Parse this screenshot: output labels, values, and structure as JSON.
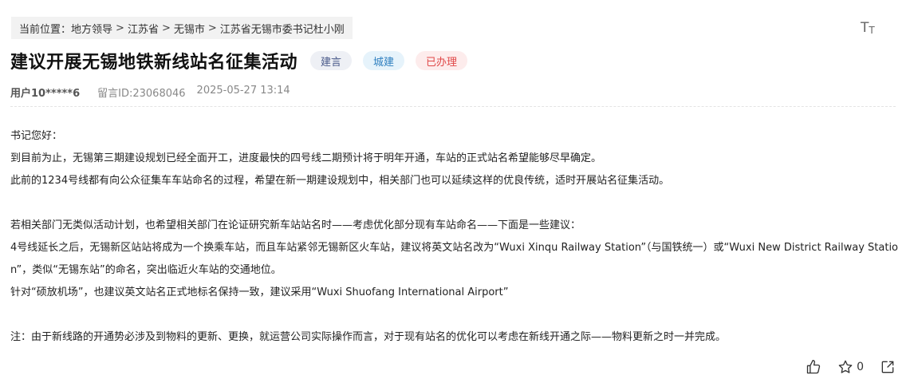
{
  "breadcrumb": {
    "prefix": "当前位置：",
    "items": [
      "地方领导",
      "江苏省",
      "无锡市",
      "江苏省无锡市委书记杜小刚"
    ],
    "separator": ">"
  },
  "font_toggle": {
    "big": "T",
    "small": "T"
  },
  "post": {
    "title": "建议开展无锡地铁新线站名征集活动",
    "tags": [
      "建言",
      "城建",
      "已办理"
    ],
    "user": "用户10*****6",
    "message_id": "留言ID:23068046",
    "datetime": "2025-05-27 13:14"
  },
  "body": {
    "p1": "书记您好：",
    "p2": "到目前为止，无锡第三期建设规划已经全面开工，进度最快的四号线二期预计将于明年开通，车站的正式站名希望能够尽早确定。",
    "p3": "此前的1234号线都有向公众征集车车站命名的过程，希望在新一期建设规划中，相关部门也可以延续这样的优良传统，适时开展站名征集活动。",
    "p4": "若相关部门无类似活动计划，也希望相关部门在论证研究新车站站名时——考虑优化部分现有车站命名——下面是一些建议：",
    "p5": " 4号线延长之后，无锡新区站站将成为一个换乘车站，而且车站紧邻无锡新区火车站，建议将英文站名改为“Wuxi Xinqu Railway Station”（与国铁统一）或“Wuxi New District Railway Station”，类似“无锡东站”的命名，突出临近火车站的交通地位。",
    "p6": " 针对“硕放机场”，也建议英文站名正式地标名保持一致，建议采用“Wuxi Shuofang International Airport”",
    "p7": "注：由于新线路的开通势必涉及到物料的更新、更换，就运营公司实际操作而言，对于现有站名的优化可以考虑在新线开通之际——物料更新之时一并完成。"
  },
  "actions": {
    "like_icon": "thumbs-up-icon",
    "favorite_icon": "star-icon",
    "favorite_count": "0",
    "share_icon": "share-icon"
  }
}
